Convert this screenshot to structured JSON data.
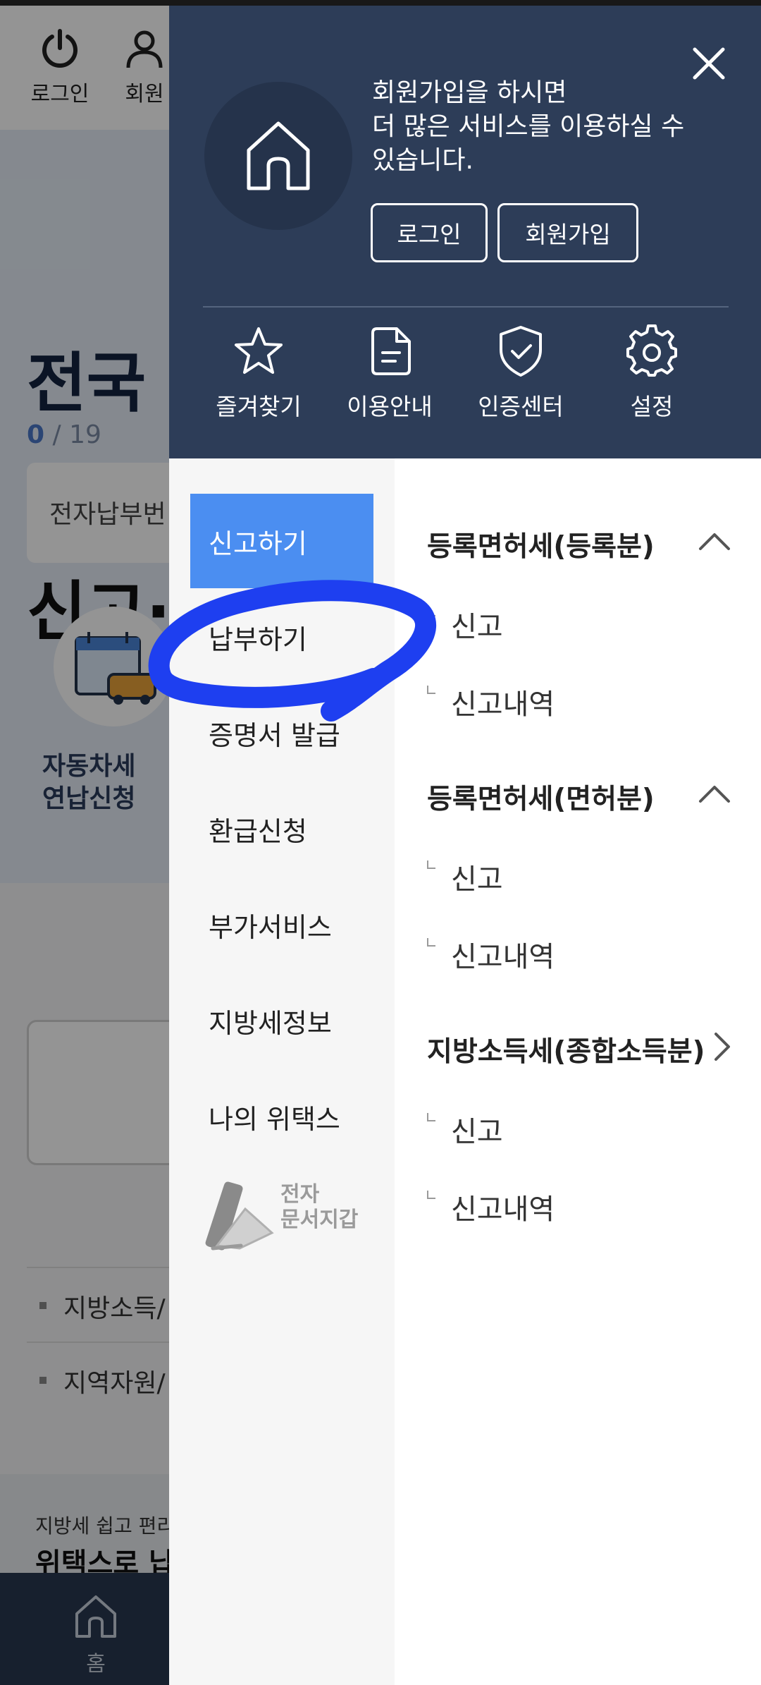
{
  "background": {
    "toolbar": {
      "login_label": "로그인",
      "member_label": "회원"
    },
    "hero": {
      "title_line1": "전국",
      "title_line2": "신고·",
      "counter_current": "0",
      "counter_total": "/ 19"
    },
    "search_placeholder": "전자납부번",
    "shortcut": {
      "label_line1": "자동차세",
      "label_line2": "연납신청"
    },
    "list_items": [
      "지방소득/",
      "지역자원/"
    ],
    "banner": {
      "small": "지방세 쉽고 편리",
      "big": "위택스로 납"
    },
    "bottom_nav": {
      "home_label": "홈"
    }
  },
  "drawer": {
    "close_label": "×",
    "welcome_lines": [
      "회원가입을 하시면",
      "더 많은 서비스를 이용하실 수",
      "있습니다."
    ],
    "login_button": "로그인",
    "join_button": "회원가입",
    "quick_links": [
      {
        "label": "즐겨찾기",
        "icon": "star-icon"
      },
      {
        "label": "이용안내",
        "icon": "document-icon"
      },
      {
        "label": "인증센터",
        "icon": "shield-check-icon"
      },
      {
        "label": "설정",
        "icon": "gear-icon"
      }
    ],
    "left_menu": [
      {
        "label": "신고하기",
        "active": true
      },
      {
        "label": "납부하기"
      },
      {
        "label": "증명서 발급"
      },
      {
        "label": "환급신청"
      },
      {
        "label": "부가서비스"
      },
      {
        "label": "지방세정보"
      },
      {
        "label": "나의 위택스"
      }
    ],
    "esign": {
      "line1": "전자",
      "line2": "문서지갑"
    },
    "sections": [
      {
        "title": "등록면허세(등록분)",
        "expanded": true,
        "items": [
          "신고",
          "신고내역"
        ]
      },
      {
        "title": "등록면허세(면허분)",
        "expanded": true,
        "items": [
          "신고",
          "신고내역"
        ]
      },
      {
        "title": "지방소득세(종합소득분)",
        "expanded": false,
        "items": [
          "신고",
          "신고내역"
        ]
      }
    ]
  },
  "colors": {
    "drawer_header": "#2d3d58",
    "active_menu": "#4b8ef1",
    "scribble": "#1e3ff0"
  }
}
